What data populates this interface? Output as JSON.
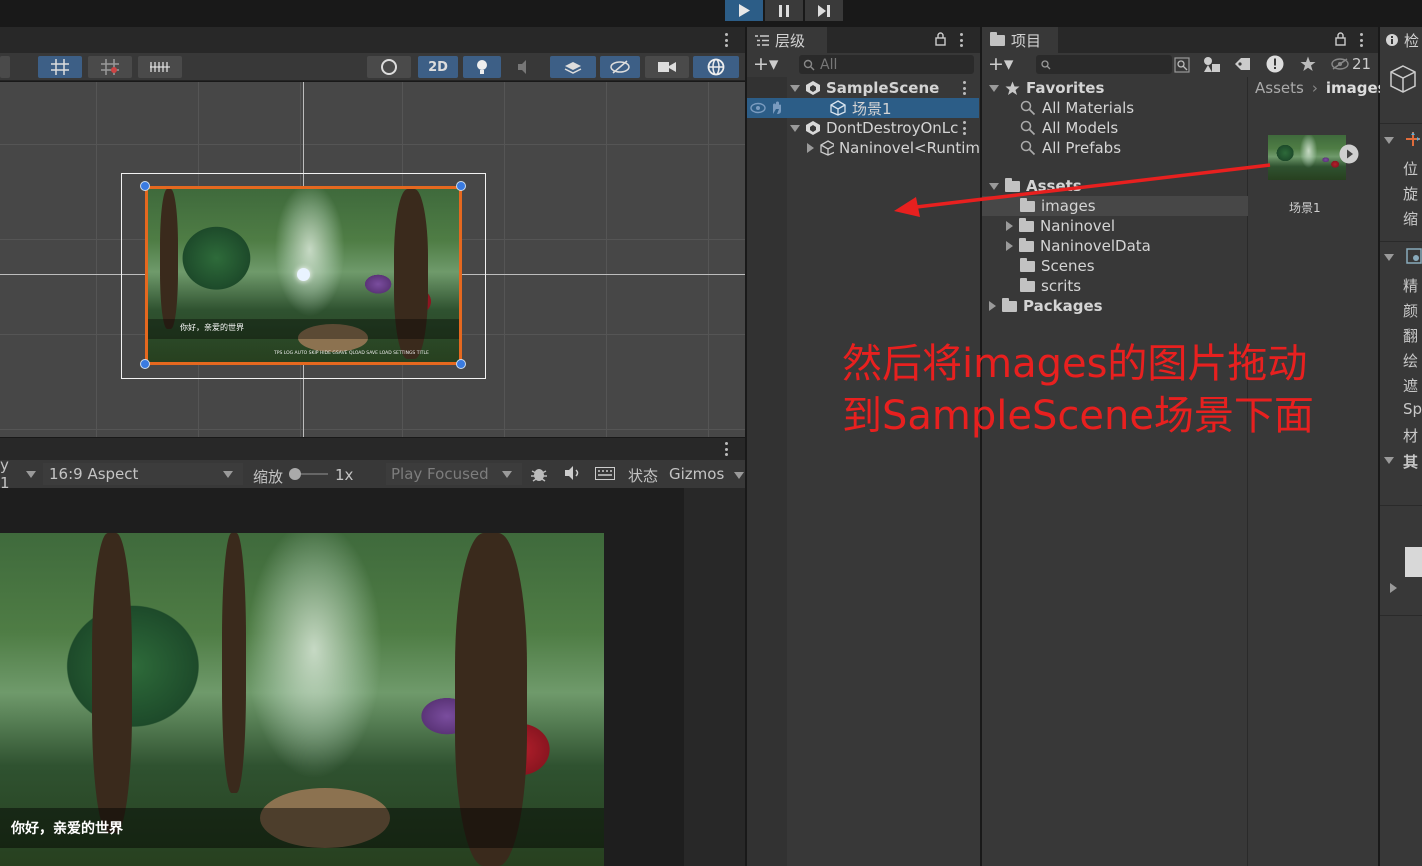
{
  "colors": {
    "accent": "#2c5d87",
    "annotation": "#e8201f",
    "handle": "#e5681f",
    "panel": "#383838"
  },
  "top_bar": {
    "play_icon": "play-icon",
    "pause_icon": "pause-icon",
    "step_icon": "step-icon"
  },
  "scene": {
    "mode_2d": "2D",
    "dialog_text": "你好，亲爱的世界",
    "bottom_buttons": "TPS LOG AUTO SKIP HIDE GSAVE QLOAD SAVE LOAD SETTINGS TITLE"
  },
  "game": {
    "display_partial": "y 1",
    "aspect": "16:9 Aspect",
    "scale_label": "缩放",
    "scale_value": "1x",
    "play_mode": "Play Focused",
    "stats_label": "状态",
    "gizmos_label": "Gizmos",
    "dialog_text": "你好，亲爱的世界"
  },
  "hierarchy": {
    "tab_label": "层级",
    "search_placeholder": "All",
    "items": [
      {
        "label": "SampleScene"
      },
      {
        "label": "场景1"
      },
      {
        "label": "DontDestroyOnLc"
      },
      {
        "label": "Naninovel<Runtim"
      }
    ]
  },
  "project": {
    "tab_label": "项目",
    "badge_count": "21",
    "favorites": {
      "label": "Favorites",
      "items": [
        "All Materials",
        "All Models",
        "All Prefabs"
      ]
    },
    "assets": {
      "label": "Assets",
      "folders": [
        "images",
        "Naninovel",
        "NaninovelData",
        "Scenes",
        "scrits"
      ]
    },
    "packages": "Packages",
    "breadcrumb": {
      "root": "Assets",
      "current": "images"
    },
    "asset_item": "场景1"
  },
  "inspector": {
    "tab_label": "检",
    "labels": [
      "位",
      "旋",
      "缩",
      "精",
      "颜",
      "翻",
      "绘",
      "遮",
      "Sp",
      "材",
      "其"
    ]
  },
  "annotation": {
    "line1": "然后将images的图片拖动",
    "line2": "到SampleScene场景下面"
  }
}
